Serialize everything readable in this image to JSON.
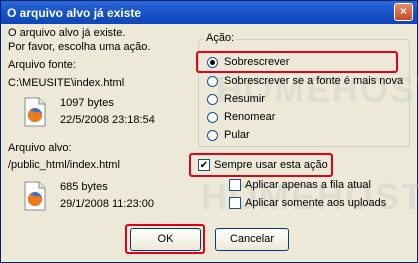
{
  "window": {
    "title": "O arquivo alvo já existe",
    "close": "×"
  },
  "message": {
    "line1": "O arquivo alvo já existe.",
    "line2": "Por favor, escolha uma ação."
  },
  "source": {
    "label": "Arquivo fonte:",
    "path": "C:\\MEUSITE\\index.html",
    "size": "1097 bytes",
    "date": "22/5/2008 23:18:54"
  },
  "target": {
    "label": "Arquivo alvo:",
    "path": "/public_html/index.html",
    "size": "685 bytes",
    "date": "29/1/2008 11:23:00"
  },
  "action_group": {
    "legend": "Ação:",
    "options": [
      {
        "label": "Sobrescrever",
        "selected": true
      },
      {
        "label": "Sobrescrever se a fonte é mais nova",
        "selected": false
      },
      {
        "label": "Resumir",
        "selected": false
      },
      {
        "label": "Renomear",
        "selected": false
      },
      {
        "label": "Pular",
        "selected": false
      }
    ]
  },
  "checkboxes": [
    {
      "label": "Sempre usar esta ação",
      "checked": true
    },
    {
      "label": "Aplicar apenas a fila atual",
      "checked": false
    },
    {
      "label": "Aplicar somente aos uploads",
      "checked": false
    }
  ],
  "buttons": {
    "ok": "OK",
    "cancel": "Cancelar"
  },
  "watermark": "HOMEHOST",
  "colors": {
    "highlight": "#e0001b",
    "titlebar": "#0d46b8"
  }
}
